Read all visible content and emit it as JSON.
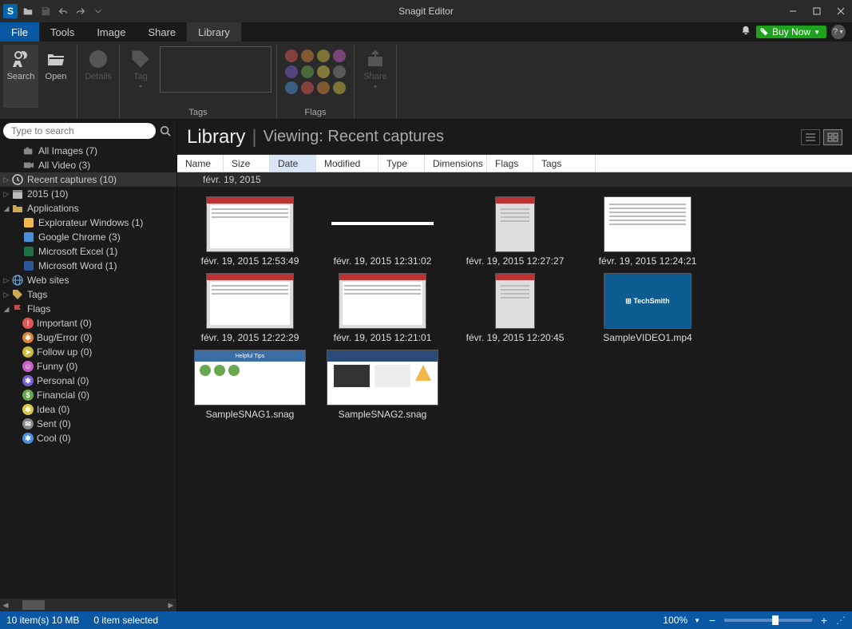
{
  "title": "Snagit Editor",
  "menu": {
    "file": "File",
    "tools": "Tools",
    "image": "Image",
    "share": "Share",
    "library": "Library",
    "buy_now": "Buy Now"
  },
  "ribbon": {
    "search": "Search",
    "open": "Open",
    "details": "Details",
    "tag": "Tag",
    "share": "Share",
    "tags_label": "Tags",
    "flags_label": "Flags"
  },
  "search_placeholder": "Type to search",
  "sidebar": {
    "all_images": "All Images (7)",
    "all_video": "All Video (3)",
    "recent": "Recent captures (10)",
    "y2015": "2015 (10)",
    "apps": "Applications",
    "explorer": "Explorateur Windows (1)",
    "chrome": "Google Chrome (3)",
    "excel": "Microsoft Excel (1)",
    "word": "Microsoft Word (1)",
    "websites": "Web sites",
    "tags": "Tags",
    "flags": "Flags",
    "flag_items": [
      {
        "label": "Important (0)",
        "color": "#e05555",
        "glyph": "!"
      },
      {
        "label": "Bug/Error (0)",
        "color": "#d9863a",
        "glyph": "✱"
      },
      {
        "label": "Follow up (0)",
        "color": "#cdbb3f",
        "glyph": "➤"
      },
      {
        "label": "Funny (0)",
        "color": "#c760c7",
        "glyph": "☺"
      },
      {
        "label": "Personal (0)",
        "color": "#7a5fcf",
        "glyph": "✱"
      },
      {
        "label": "Financial (0)",
        "color": "#6aa84f",
        "glyph": "$"
      },
      {
        "label": "Idea (0)",
        "color": "#d9c94a",
        "glyph": "✱"
      },
      {
        "label": "Sent (0)",
        "color": "#888888",
        "glyph": "✉"
      },
      {
        "label": "Cool (0)",
        "color": "#4a90d9",
        "glyph": "✱"
      }
    ]
  },
  "main": {
    "title": "Library",
    "viewing_label": "Viewing:",
    "viewing_value": "Recent captures",
    "columns": {
      "name": "Name",
      "size": "Size",
      "date": "Date",
      "modified": "Modified",
      "type": "Type",
      "dimensions": "Dimensions",
      "flags": "Flags",
      "tags": "Tags"
    },
    "group_date": "févr. 19, 2015",
    "items": [
      {
        "caption": "févr. 19, 2015 12:53:49",
        "kind": "web"
      },
      {
        "caption": "févr. 19, 2015 12:31:02",
        "kind": "blank"
      },
      {
        "caption": "févr. 19, 2015 12:27:27",
        "kind": "narrow"
      },
      {
        "caption": "févr. 19, 2015 12:24:21",
        "kind": "doc"
      },
      {
        "caption": "févr. 19, 2015 12:22:29",
        "kind": "web2"
      },
      {
        "caption": "févr. 19, 2015 12:21:01",
        "kind": "web2"
      },
      {
        "caption": "févr. 19, 2015 12:20:45",
        "kind": "narrow"
      },
      {
        "caption": "SampleVIDEO1.mp4",
        "kind": "video"
      },
      {
        "caption": "SampleSNAG1.snag",
        "kind": "snag1"
      },
      {
        "caption": "SampleSNAG2.snag",
        "kind": "snag2"
      }
    ]
  },
  "status": {
    "items": "10 item(s) 10 MB",
    "selected": "0 item selected",
    "zoom": "100%"
  },
  "colors": {
    "flags": [
      "#e05555",
      "#d9863a",
      "#cdbb3f",
      "#c760c7",
      "#7a5fcf",
      "#6aa84f",
      "#d9c94a",
      "#888888",
      "#4a90d9",
      "#e05555",
      "#d9863a",
      "#cdbb3f"
    ]
  }
}
